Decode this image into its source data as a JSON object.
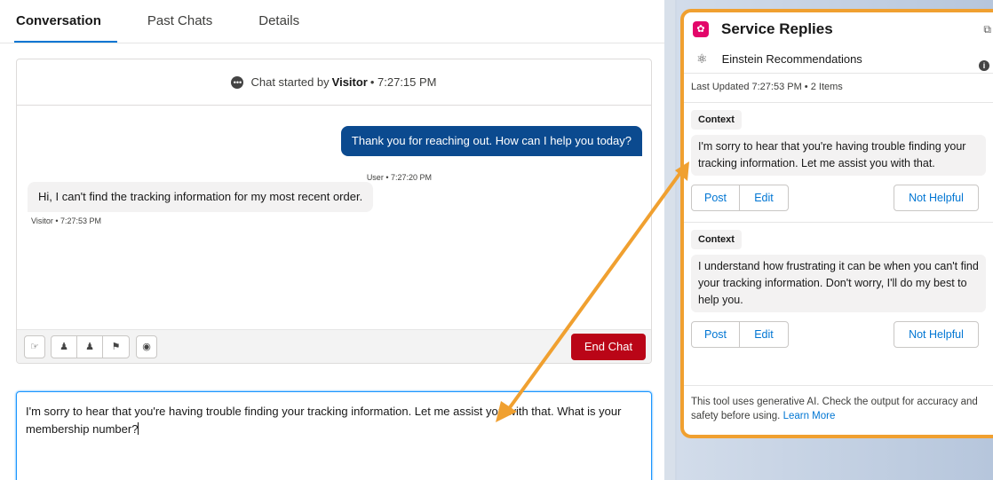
{
  "tabs": [
    {
      "label": "Conversation",
      "active": true
    },
    {
      "label": "Past Chats",
      "active": false
    },
    {
      "label": "Details",
      "active": false
    }
  ],
  "chat": {
    "header_prefix": "Chat started by",
    "header_name": "Visitor",
    "header_suffix": "• 7:27:15 PM",
    "messages": [
      {
        "from": "agent",
        "text": "Thank you for reaching out. How can I help you today?",
        "meta": "User • 7:27:20 PM"
      },
      {
        "from": "visitor",
        "text": "Hi, I can't find the tracking information for my most recent order.",
        "meta": "Visitor • 7:27:53 PM"
      }
    ],
    "end_chat_label": "End Chat",
    "composer_text": "I'm sorry to hear that you're having trouble finding your tracking information. Let me assist you with that. What is your membership number?"
  },
  "service_replies": {
    "title": "Service Replies",
    "source": "Einstein Recommendations",
    "last_updated": "Last Updated 7:27:53 PM • 2 Items",
    "recommendations": [
      {
        "label": "Context",
        "text": "I'm sorry to hear that you're having trouble finding your tracking information. Let me assist you with that.",
        "post": "Post",
        "edit": "Edit",
        "not_helpful": "Not Helpful"
      },
      {
        "label": "Context",
        "text": "I understand how frustrating it can be when you can't find your tracking information. Don't worry, I'll do my best to help you.",
        "post": "Post",
        "edit": "Edit",
        "not_helpful": "Not Helpful"
      }
    ],
    "disclaimer": "This tool uses generative AI. Check the output for accuracy and safety before using.",
    "learn_more": "Learn More"
  },
  "colors": {
    "accent": "#0176d3",
    "agent_bubble": "#0b4a8f",
    "end_chat": "#ba0517",
    "highlight": "#f0a030",
    "brand": "#e3066a"
  },
  "icons": {
    "chat": "chat-bubble-icon",
    "toolbar": [
      "transfer-icon",
      "escalate-icon",
      "add-agent-icon",
      "flag-icon",
      "quick-text-icon"
    ],
    "panel": "service-replies-icon",
    "popout": "popout-icon",
    "einstein": "einstein-atom-icon",
    "info": "info-icon"
  }
}
